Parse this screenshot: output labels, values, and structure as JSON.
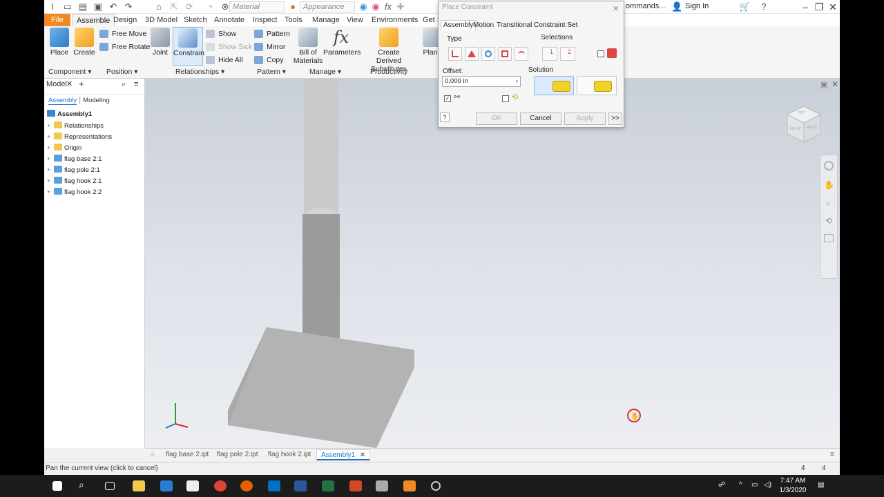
{
  "qat": {
    "material": "Material",
    "appearance": "Appearance",
    "search_fragment": "ommands...",
    "sign_in": "Sign In"
  },
  "ribbon_tabs": [
    "File",
    "Assemble",
    "Design",
    "3D Model",
    "Sketch",
    "Annotate",
    "Inspect",
    "Tools",
    "Manage",
    "View",
    "Environments",
    "Get S"
  ],
  "ribbon": {
    "place": "Place",
    "create": "Create",
    "free_move": "Free Move",
    "free_rotate": "Free Rotate",
    "joint": "Joint",
    "constrain": "Constrain",
    "show": "Show",
    "show_sick": "Show Sick",
    "hide_all": "Hide All",
    "pattern": "Pattern",
    "mirror": "Mirror",
    "copy": "Copy",
    "bom_1": "Bill of",
    "bom_2": "Materials",
    "parameters": "Parameters",
    "cds_1": "Create Derived",
    "cds_2": "Substitutes",
    "plan": "Plan",
    "groups": {
      "component": "Component",
      "position": "Position",
      "relationships": "Relationships",
      "pattern": "Pattern",
      "manage": "Manage",
      "productivity": "Productivity"
    }
  },
  "browser": {
    "title": "Model",
    "tab_assembly": "Assembly",
    "tab_modeling": "Modeling",
    "root": "Assembly1",
    "items": [
      "Relationships",
      "Representations",
      "Origin",
      "flag base 2:1",
      "flag pole 2:1",
      "flag hook 2:1",
      "flag hook 2:2"
    ]
  },
  "dialog": {
    "title": "Place Constraint",
    "tabs": [
      "Assembly",
      "Motion",
      "Transitional",
      "Constraint Set"
    ],
    "type_label": "Type",
    "selections_label": "Selections",
    "sel1": "1",
    "sel2": "2",
    "offset_label": "Offset:",
    "offset_value": "0.000 in",
    "solution_label": "Solution",
    "ok": "OK",
    "cancel": "Cancel",
    "apply": "Apply",
    "more": ">>",
    "help": "?"
  },
  "viewcube": {
    "top": "TOP",
    "front": "FRONT",
    "right": "RIGHT"
  },
  "doc_tabs": [
    "flag base 2.ipt",
    "flag pole 2.ipt",
    "flag hook 2.ipt",
    "Assembly1"
  ],
  "status": {
    "message": "Pan the current view (click to cancel)",
    "count1": "4",
    "count2": "4"
  },
  "taskbar": {
    "time": "7:47 AM",
    "date": "1/3/2020"
  },
  "colors": {
    "file_tab": "#f08a24",
    "accent": "#1a73c6"
  }
}
